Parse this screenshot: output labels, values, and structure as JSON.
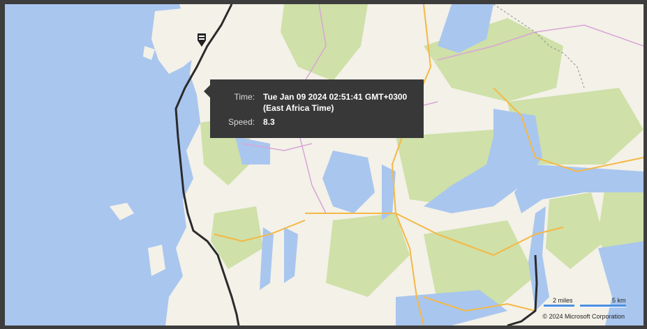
{
  "map": {
    "tooltip": {
      "time_label": "Time:",
      "time_value": "Tue Jan 09 2024 02:51:41 GMT+0300 (East Africa Time)",
      "speed_label": "Speed:",
      "speed_value": "8.3"
    },
    "scale": {
      "miles_label": "2 miles",
      "km_label": "5 km"
    },
    "copyright": "© 2024 Microsoft Corporation",
    "colors": {
      "water": "#a9c6ef",
      "land": "#f3f1e8",
      "forest": "#cfe0a8",
      "track": "#2b2b2b",
      "road_major": "#f5b845",
      "road_minor": "#d9a5d6"
    },
    "icons": [
      "vessel-marker-icon"
    ]
  }
}
